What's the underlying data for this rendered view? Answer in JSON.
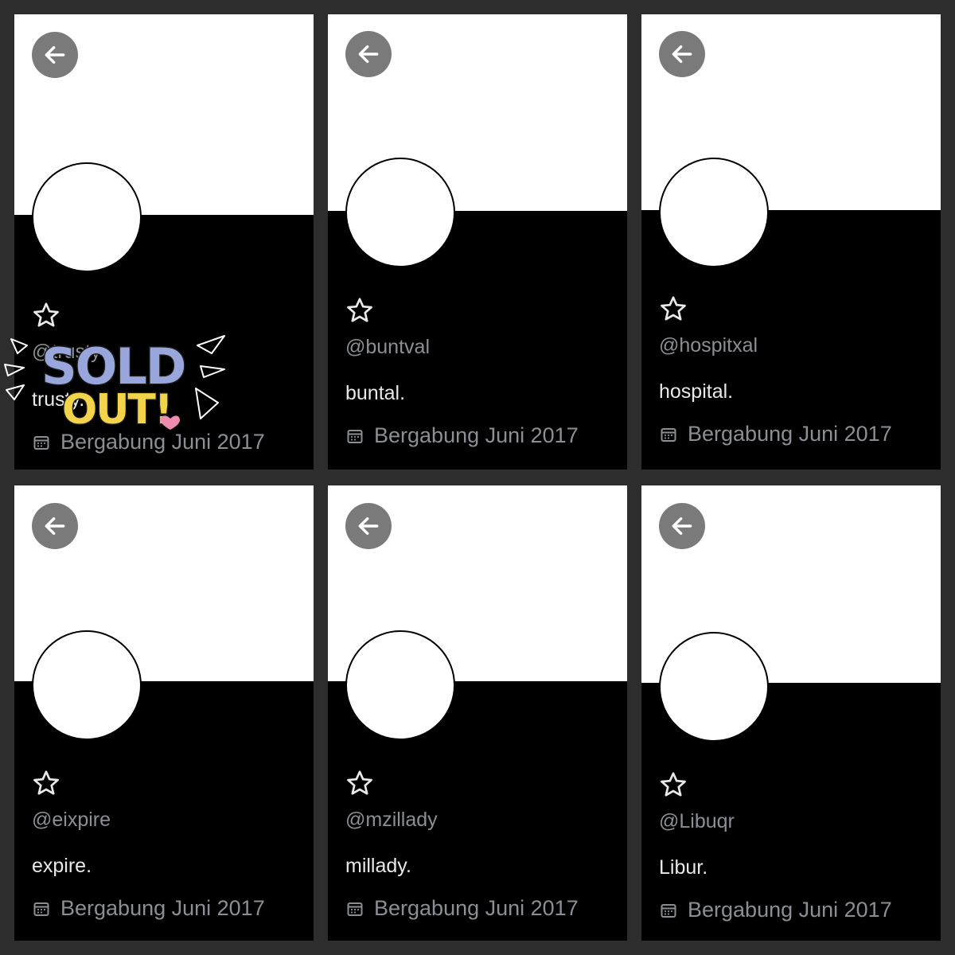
{
  "colors": {
    "page_bg": "#2d2d2d",
    "banner_top": "#ffffff",
    "banner_bottom": "#000000",
    "back_button": "#7a7a7a",
    "muted_text": "#8b8f94",
    "name_text": "#e7e9ea",
    "sticker_fill": "#98a6dc",
    "sticker_fill_2": "#f3d34a",
    "sticker_heart": "#f08bb0"
  },
  "icons": {
    "back": "arrow-left-icon",
    "star": "star-outline-icon",
    "calendar": "calendar-icon",
    "avatar": "anime-avatar-image"
  },
  "sticker": {
    "line1": "SOLD",
    "line2": "OUT!"
  },
  "profiles": [
    {
      "star": "☆",
      "handle": "@trusty",
      "name": "trusty.",
      "joined": "Bergabung Juni 2017"
    },
    {
      "star": "☆",
      "handle": "@buntval",
      "name": "buntal.",
      "joined": "Bergabung Juni 2017"
    },
    {
      "star": "☆",
      "handle": "@hospitxal",
      "name": "hospital.",
      "joined": "Bergabung Juni 2017"
    },
    {
      "star": "☆",
      "handle": "@eixpire",
      "name": "expire.",
      "joined": "Bergabung Juni 2017"
    },
    {
      "star": "☆",
      "handle": "@mzillady",
      "name": "millady.",
      "joined": "Bergabung Juni 2017"
    },
    {
      "star": "☆",
      "handle": "@Libuqr",
      "name": "Libur.",
      "joined": "Bergabung Juni 2017"
    }
  ]
}
